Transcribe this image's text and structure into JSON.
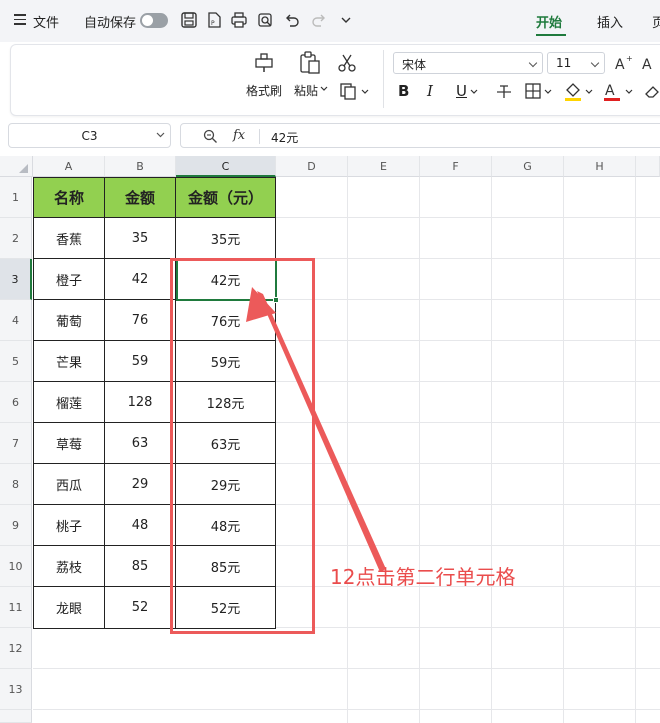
{
  "titlebar": {
    "file_label": "文件",
    "autosave_label": "自动保存",
    "tabs": [
      {
        "label": "开始",
        "active": true
      },
      {
        "label": "插入",
        "active": false
      },
      {
        "label": "页",
        "active": false
      }
    ]
  },
  "ribbon": {
    "format_painter_label": "格式刷",
    "paste_label": "粘贴",
    "font_name": "宋体",
    "font_size": "11",
    "bold": "B",
    "italic": "I",
    "underline": "U",
    "font_color_accent": "#e02020",
    "fill_color_accent": "#ffd400"
  },
  "formula_bar": {
    "cell_ref": "C3",
    "fx_label": "fx",
    "value": "42元"
  },
  "columns": [
    "A",
    "B",
    "C",
    "D",
    "E",
    "F",
    "G",
    "H"
  ],
  "rows": [
    "1",
    "2",
    "3",
    "4",
    "5",
    "6",
    "7",
    "8",
    "9",
    "10",
    "11",
    "12",
    "13"
  ],
  "table": {
    "headers": [
      "名称",
      "金额",
      "金额（元）"
    ],
    "rows": [
      [
        "香蕉",
        "35",
        "35元"
      ],
      [
        "橙子",
        "42",
        "42元"
      ],
      [
        "葡萄",
        "76",
        "76元"
      ],
      [
        "芒果",
        "59",
        "59元"
      ],
      [
        "榴莲",
        "128",
        "128元"
      ],
      [
        "草莓",
        "63",
        "63元"
      ],
      [
        "西瓜",
        "29",
        "29元"
      ],
      [
        "桃子",
        "48",
        "48元"
      ],
      [
        "荔枝",
        "85",
        "85元"
      ],
      [
        "龙眼",
        "52",
        "52元"
      ]
    ]
  },
  "annotation": {
    "text": "12点击第二行单元格",
    "color": "#ea4c4c"
  },
  "colors": {
    "accent_green": "#1f7a3d",
    "header_fill": "#92d050"
  }
}
